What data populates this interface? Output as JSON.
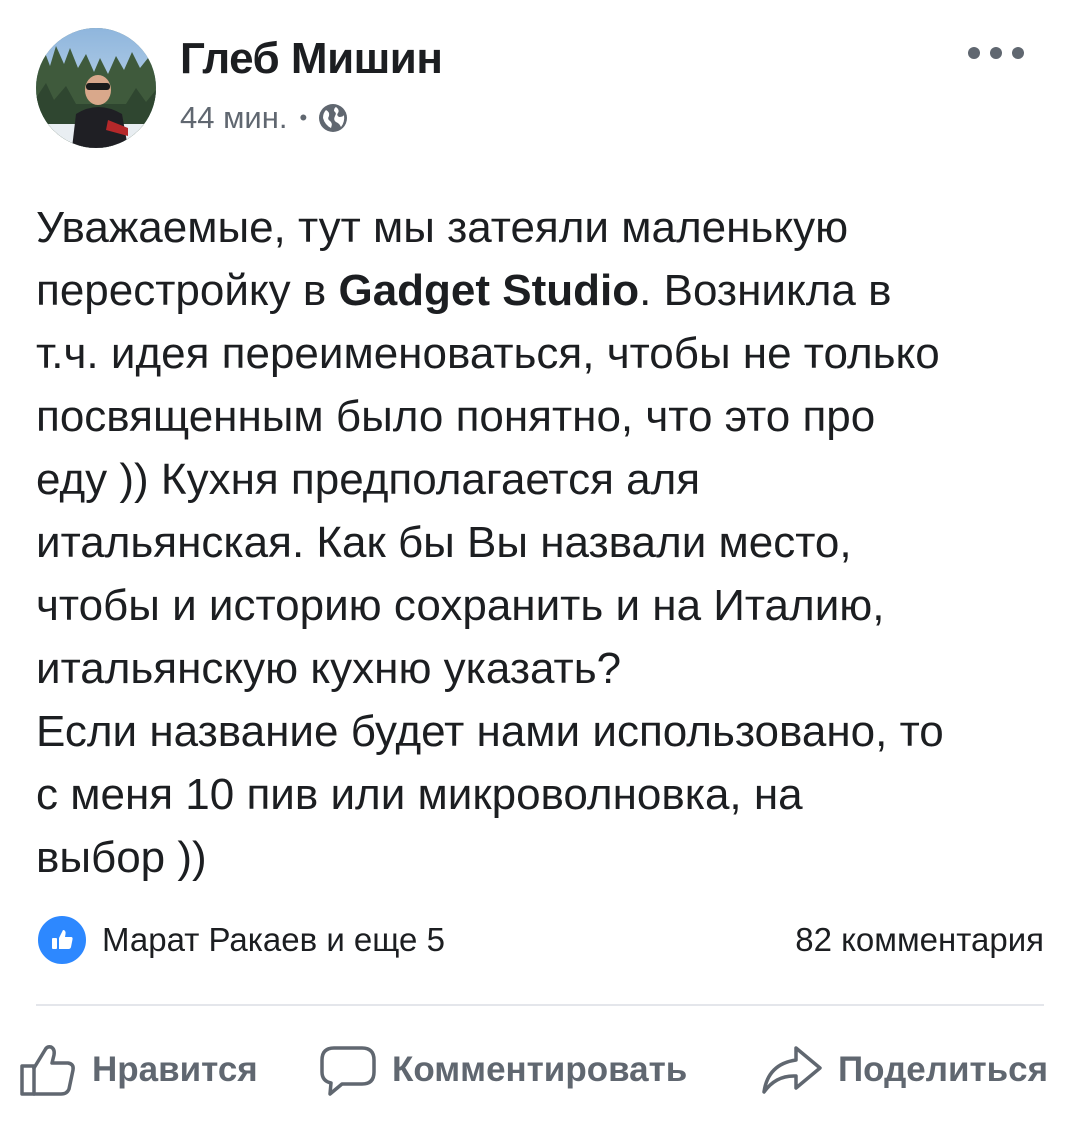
{
  "post": {
    "author": "Глеб Мишин",
    "time": "44 мин.",
    "separator": "•",
    "privacy_icon": "globe-icon",
    "more_icon": "more-options-icon",
    "text_lines": [
      {
        "parts": [
          {
            "t": "Уважаемые, тут мы затеяли маленькую",
            "bold": false
          }
        ]
      },
      {
        "parts": [
          {
            "t": "перестройку в ",
            "bold": false
          },
          {
            "t": "Gadget Studio",
            "bold": true
          },
          {
            "t": ". Возникла в",
            "bold": false
          }
        ]
      },
      {
        "parts": [
          {
            "t": "т.ч. идея переименоваться, чтобы не только",
            "bold": false
          }
        ]
      },
      {
        "parts": [
          {
            "t": "посвященным было понятно, что это про",
            "bold": false
          }
        ]
      },
      {
        "parts": [
          {
            "t": "еду )) Кухня предполагается аля",
            "bold": false
          }
        ]
      },
      {
        "parts": [
          {
            "t": "итальянская. Как бы Вы назвали место,",
            "bold": false
          }
        ]
      },
      {
        "parts": [
          {
            "t": "чтобы и историю сохранить и на Италию,",
            "bold": false
          }
        ]
      },
      {
        "parts": [
          {
            "t": "итальянскую кухню указать?",
            "bold": false
          }
        ]
      },
      {
        "parts": [
          {
            "t": "Если название будет нами использовано, то",
            "bold": false
          }
        ]
      },
      {
        "parts": [
          {
            "t": "с меня 10 пив или микроволновка, на",
            "bold": false
          }
        ]
      },
      {
        "parts": [
          {
            "t": "выбор ))",
            "bold": false
          }
        ]
      }
    ]
  },
  "reactions": {
    "icon": "like-badge-icon",
    "reactors": "Марат Ракаев и еще 5",
    "comments": "82 комментария"
  },
  "actions": {
    "like": {
      "label": "Нравится",
      "icon": "thumbs-up-icon"
    },
    "comment": {
      "label": "Комментировать",
      "icon": "comment-bubble-icon"
    },
    "share": {
      "label": "Поделиться",
      "icon": "share-arrow-icon"
    }
  },
  "colors": {
    "text": "#1c1e21",
    "secondary": "#606770",
    "like_blue": "#2d88ff",
    "divider": "#e4e6eb"
  }
}
